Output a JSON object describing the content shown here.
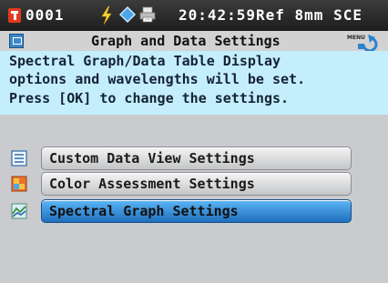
{
  "status_bar": {
    "sample_number": "0001",
    "time": "20:42:59",
    "measurement_mode": "Ref 8mm SCE",
    "icons": [
      "data-badge-icon",
      "lightning-bolt-icon",
      "diamond-icon",
      "printer-icon"
    ]
  },
  "header": {
    "title": "Graph and Data Settings",
    "menu_button_label": "MENU"
  },
  "description": {
    "lines": [
      "Spectral Graph/Data Table Display",
      "options and wavelengths will be set.",
      "Press [OK] to change the settings."
    ]
  },
  "menu": {
    "selected_index": 2,
    "items": [
      {
        "label": "Custom Data View Settings",
        "icon": "list-icon"
      },
      {
        "label": "Color Assessment Settings",
        "icon": "color-assessment-icon"
      },
      {
        "label": "Spectral Graph Settings",
        "icon": "spectral-graph-icon"
      }
    ]
  },
  "colors": {
    "status_bar_bg": "#2a2a2a",
    "description_bg": "#c5eefd",
    "screen_bg": "#c9cbce",
    "selected_item": "#2c86d6",
    "accent_red": "#e23a1c"
  }
}
